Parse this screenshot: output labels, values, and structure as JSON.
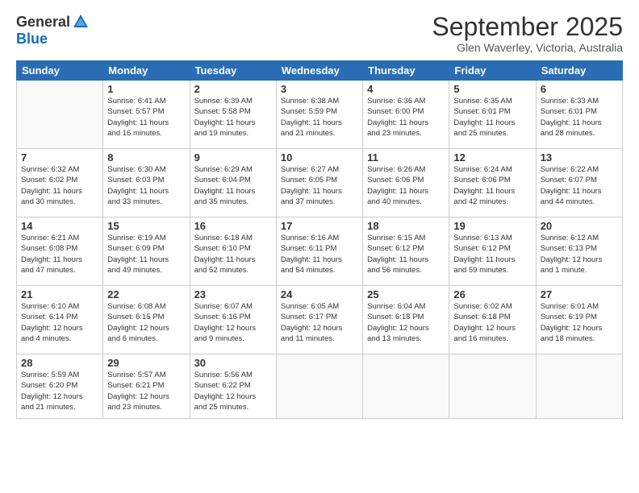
{
  "logo": {
    "general": "General",
    "blue": "Blue"
  },
  "title": "September 2025",
  "location": "Glen Waverley, Victoria, Australia",
  "days_header": [
    "Sunday",
    "Monday",
    "Tuesday",
    "Wednesday",
    "Thursday",
    "Friday",
    "Saturday"
  ],
  "weeks": [
    [
      {
        "day": "",
        "info": ""
      },
      {
        "day": "1",
        "info": "Sunrise: 6:41 AM\nSunset: 5:57 PM\nDaylight: 11 hours\nand 16 minutes."
      },
      {
        "day": "2",
        "info": "Sunrise: 6:39 AM\nSunset: 5:58 PM\nDaylight: 11 hours\nand 19 minutes."
      },
      {
        "day": "3",
        "info": "Sunrise: 6:38 AM\nSunset: 5:59 PM\nDaylight: 11 hours\nand 21 minutes."
      },
      {
        "day": "4",
        "info": "Sunrise: 6:36 AM\nSunset: 6:00 PM\nDaylight: 11 hours\nand 23 minutes."
      },
      {
        "day": "5",
        "info": "Sunrise: 6:35 AM\nSunset: 6:01 PM\nDaylight: 11 hours\nand 25 minutes."
      },
      {
        "day": "6",
        "info": "Sunrise: 6:33 AM\nSunset: 6:01 PM\nDaylight: 11 hours\nand 28 minutes."
      }
    ],
    [
      {
        "day": "7",
        "info": "Sunrise: 6:32 AM\nSunset: 6:02 PM\nDaylight: 11 hours\nand 30 minutes."
      },
      {
        "day": "8",
        "info": "Sunrise: 6:30 AM\nSunset: 6:03 PM\nDaylight: 11 hours\nand 33 minutes."
      },
      {
        "day": "9",
        "info": "Sunrise: 6:29 AM\nSunset: 6:04 PM\nDaylight: 11 hours\nand 35 minutes."
      },
      {
        "day": "10",
        "info": "Sunrise: 6:27 AM\nSunset: 6:05 PM\nDaylight: 11 hours\nand 37 minutes."
      },
      {
        "day": "11",
        "info": "Sunrise: 6:26 AM\nSunset: 6:06 PM\nDaylight: 11 hours\nand 40 minutes."
      },
      {
        "day": "12",
        "info": "Sunrise: 6:24 AM\nSunset: 6:06 PM\nDaylight: 11 hours\nand 42 minutes."
      },
      {
        "day": "13",
        "info": "Sunrise: 6:22 AM\nSunset: 6:07 PM\nDaylight: 11 hours\nand 44 minutes."
      }
    ],
    [
      {
        "day": "14",
        "info": "Sunrise: 6:21 AM\nSunset: 6:08 PM\nDaylight: 11 hours\nand 47 minutes."
      },
      {
        "day": "15",
        "info": "Sunrise: 6:19 AM\nSunset: 6:09 PM\nDaylight: 11 hours\nand 49 minutes."
      },
      {
        "day": "16",
        "info": "Sunrise: 6:18 AM\nSunset: 6:10 PM\nDaylight: 11 hours\nand 52 minutes."
      },
      {
        "day": "17",
        "info": "Sunrise: 6:16 AM\nSunset: 6:11 PM\nDaylight: 11 hours\nand 54 minutes."
      },
      {
        "day": "18",
        "info": "Sunrise: 6:15 AM\nSunset: 6:12 PM\nDaylight: 11 hours\nand 56 minutes."
      },
      {
        "day": "19",
        "info": "Sunrise: 6:13 AM\nSunset: 6:12 PM\nDaylight: 11 hours\nand 59 minutes."
      },
      {
        "day": "20",
        "info": "Sunrise: 6:12 AM\nSunset: 6:13 PM\nDaylight: 12 hours\nand 1 minute."
      }
    ],
    [
      {
        "day": "21",
        "info": "Sunrise: 6:10 AM\nSunset: 6:14 PM\nDaylight: 12 hours\nand 4 minutes."
      },
      {
        "day": "22",
        "info": "Sunrise: 6:08 AM\nSunset: 6:15 PM\nDaylight: 12 hours\nand 6 minutes."
      },
      {
        "day": "23",
        "info": "Sunrise: 6:07 AM\nSunset: 6:16 PM\nDaylight: 12 hours\nand 9 minutes."
      },
      {
        "day": "24",
        "info": "Sunrise: 6:05 AM\nSunset: 6:17 PM\nDaylight: 12 hours\nand 11 minutes."
      },
      {
        "day": "25",
        "info": "Sunrise: 6:04 AM\nSunset: 6:18 PM\nDaylight: 12 hours\nand 13 minutes."
      },
      {
        "day": "26",
        "info": "Sunrise: 6:02 AM\nSunset: 6:18 PM\nDaylight: 12 hours\nand 16 minutes."
      },
      {
        "day": "27",
        "info": "Sunrise: 6:01 AM\nSunset: 6:19 PM\nDaylight: 12 hours\nand 18 minutes."
      }
    ],
    [
      {
        "day": "28",
        "info": "Sunrise: 5:59 AM\nSunset: 6:20 PM\nDaylight: 12 hours\nand 21 minutes."
      },
      {
        "day": "29",
        "info": "Sunrise: 5:57 AM\nSunset: 6:21 PM\nDaylight: 12 hours\nand 23 minutes."
      },
      {
        "day": "30",
        "info": "Sunrise: 5:56 AM\nSunset: 6:22 PM\nDaylight: 12 hours\nand 25 minutes."
      },
      {
        "day": "",
        "info": ""
      },
      {
        "day": "",
        "info": ""
      },
      {
        "day": "",
        "info": ""
      },
      {
        "day": "",
        "info": ""
      }
    ]
  ]
}
